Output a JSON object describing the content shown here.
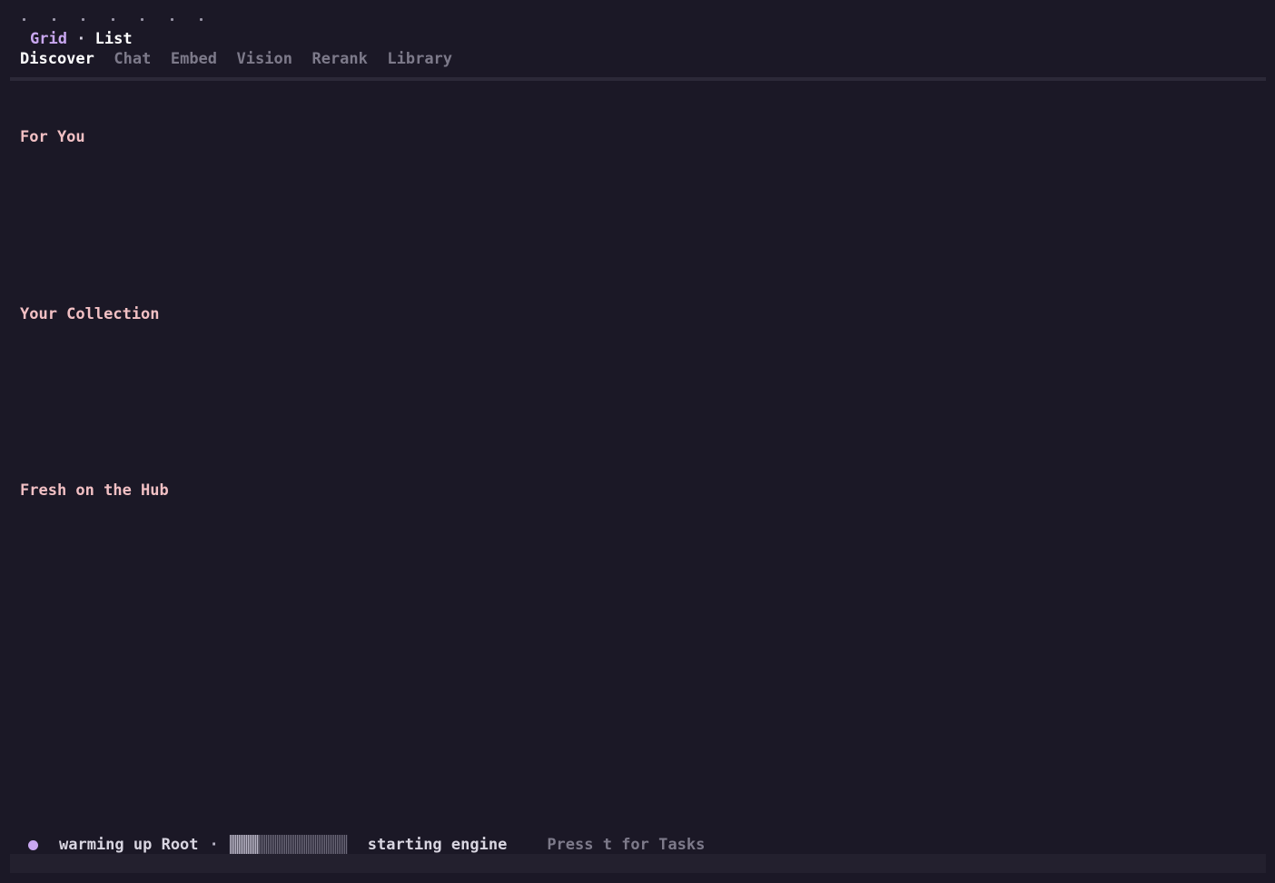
{
  "colors": {
    "background": "#1b1826",
    "accent": "#c9a7f0",
    "section_title": "#f2c0c4",
    "muted": "#7d7a8a"
  },
  "spinner": {
    "glyphs": [
      "·",
      "·",
      "·",
      "·",
      "·",
      "·",
      "·"
    ]
  },
  "view_toggle": {
    "grid_label": "Grid",
    "separator": " · ",
    "list_label": "List",
    "active": "Grid"
  },
  "tabs": [
    {
      "label": "Discover",
      "active": true
    },
    {
      "label": "Chat",
      "active": false
    },
    {
      "label": "Embed",
      "active": false
    },
    {
      "label": "Vision",
      "active": false
    },
    {
      "label": "Rerank",
      "active": false
    },
    {
      "label": "Library",
      "active": false
    }
  ],
  "sections": [
    {
      "title": "For You"
    },
    {
      "title": "Your Collection"
    },
    {
      "title": "Fresh on the Hub"
    }
  ],
  "status": {
    "indicator_icon": "status-dot-icon",
    "message": "warming up Root",
    "separator": "·",
    "progress": 0.25,
    "step": "starting engine",
    "hint": "Press t for Tasks"
  }
}
